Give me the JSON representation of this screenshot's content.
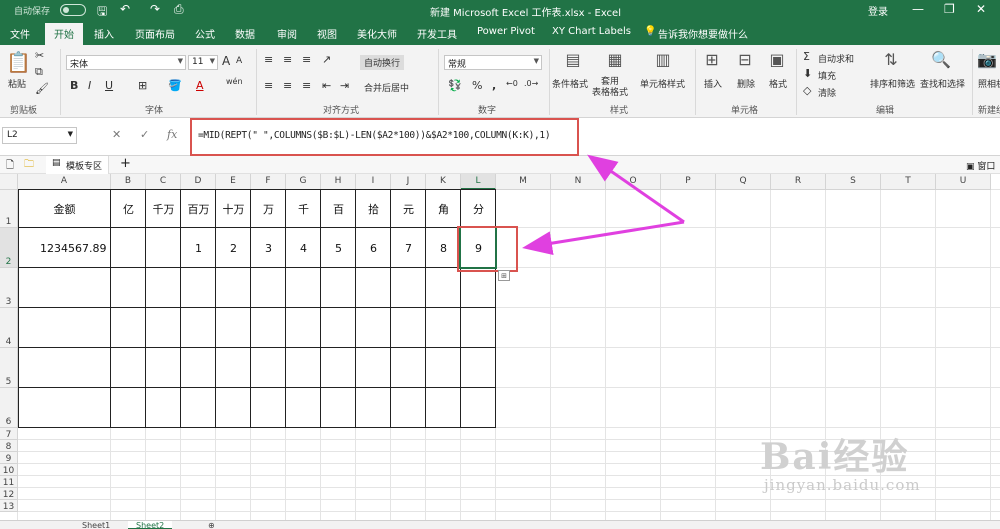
{
  "titlebar": {
    "autosave": "自动保存",
    "title": "新建 Microsoft Excel 工作表.xlsx - Excel",
    "login": "登录",
    "window_controls": [
      "—",
      "❐",
      "✕"
    ]
  },
  "tabs": [
    "文件",
    "开始",
    "插入",
    "页面布局",
    "公式",
    "数据",
    "审阅",
    "视图",
    "美化大师",
    "开发工具",
    "Power Pivot",
    "XY Chart Labels",
    "告诉我你想要做什么"
  ],
  "active_tab": "开始",
  "ribbon": {
    "clipboard": {
      "paste": "粘贴",
      "label": "剪贴板"
    },
    "font": {
      "name": "宋体",
      "size": "11",
      "bold": "B",
      "italic": "I",
      "underline": "U",
      "grow": "A",
      "shrink": "A",
      "font_color": "A",
      "highlight": "A",
      "wen": "wén",
      "label": "字体"
    },
    "alignment": {
      "wrap": "自动换行",
      "merge": "合并后居中",
      "label": "对齐方式"
    },
    "number": {
      "format": "常规",
      "percent": "%",
      "comma": ",",
      "label": "数字"
    },
    "styles": {
      "conditional": "条件格式",
      "table": "套用\n表格格式",
      "cell_styles": "单元格样式",
      "label": "样式"
    },
    "cells": {
      "insert": "插入",
      "delete": "删除",
      "format": "格式",
      "label": "单元格"
    },
    "editing": {
      "autosum": "自动求和",
      "fill": "填充",
      "clear": "清除",
      "sort": "排序和筛选",
      "find": "查找和选择",
      "label": "编辑"
    },
    "new_group": {
      "share": "照相机",
      "label": "新建组"
    }
  },
  "formula_bar": {
    "namebox": "L2",
    "formula": "=MID(REPT(\" \",COLUMNS($B:$L)-LEN($A2*100))&$A2*100,COLUMN(K:K),1)"
  },
  "workbook_tab": {
    "label": "模板专区",
    "add": "+",
    "window": "窗口"
  },
  "columns": [
    "A",
    "B",
    "C",
    "D",
    "E",
    "F",
    "G",
    "H",
    "I",
    "J",
    "K",
    "L",
    "M",
    "N",
    "O",
    "P",
    "Q",
    "R",
    "S",
    "T",
    "U"
  ],
  "rows": [
    "1",
    "2",
    "3",
    "4",
    "5",
    "6",
    "7",
    "8",
    "9",
    "10",
    "11",
    "12",
    "13"
  ],
  "sheet": {
    "header_row": [
      "金额",
      "亿",
      "千万",
      "百万",
      "十万",
      "万",
      "千",
      "百",
      "拾",
      "元",
      "角",
      "分"
    ],
    "data_row": [
      "1234567.89",
      "",
      "",
      "1",
      "2",
      "3",
      "4",
      "5",
      "6",
      "7",
      "8",
      "9"
    ]
  },
  "sheets": [
    "Sheet1",
    "Sheet2"
  ],
  "active_sheet": "Sheet2",
  "watermark": {
    "brand": "Bai经验",
    "url": "jingyan.baidu.com"
  },
  "colors": {
    "excel_green": "#217346",
    "highlight_red": "#d9534f",
    "arrow_magenta": "#e040e0"
  }
}
